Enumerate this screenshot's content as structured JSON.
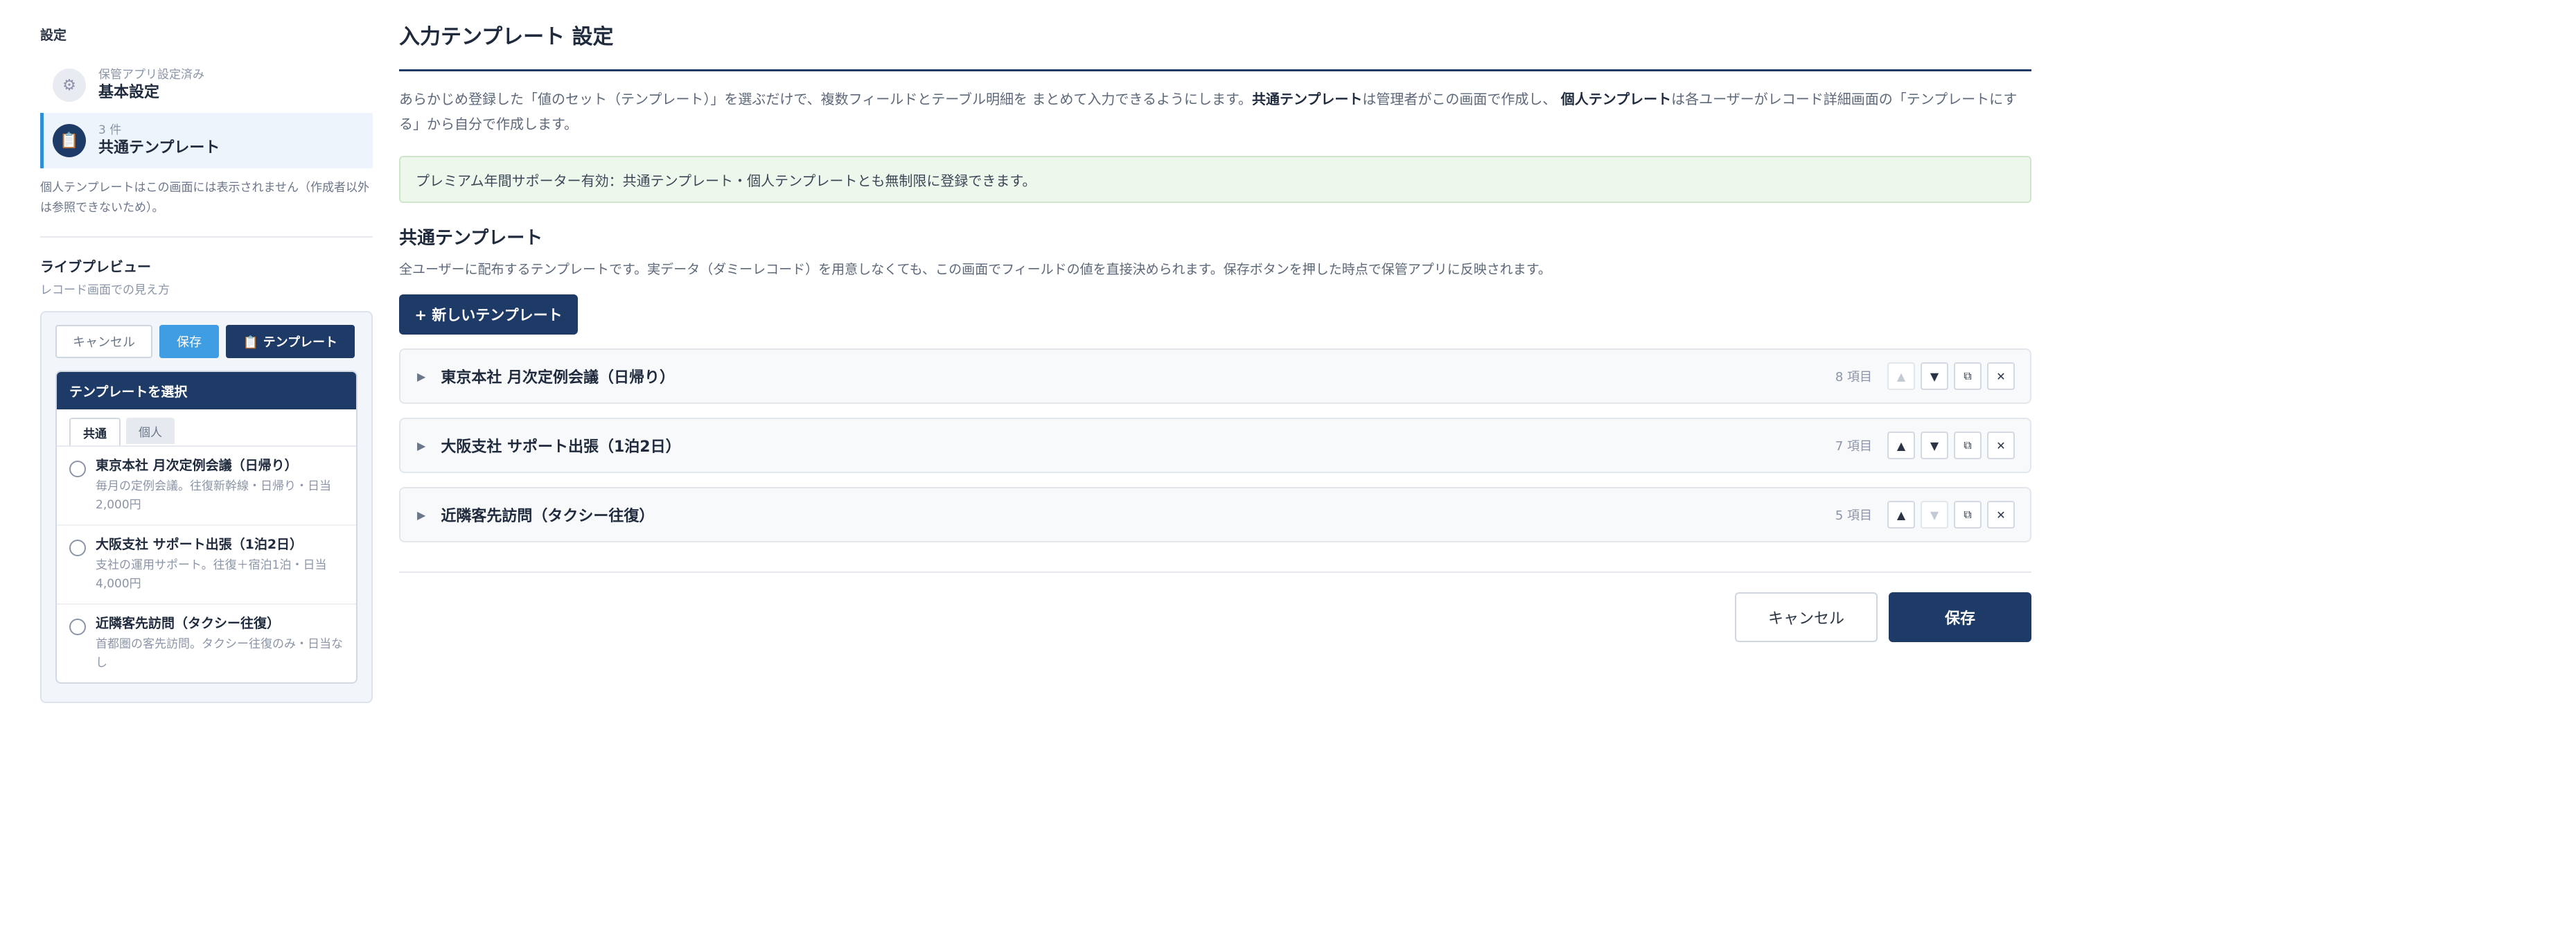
{
  "sidebar": {
    "title": "設定",
    "items": [
      {
        "sub": "保管アプリ設定済み",
        "label": "基本設定",
        "icon": "gear-icon"
      },
      {
        "sub": "3 件",
        "label": "共通テンプレート",
        "icon": "clipboard-icon"
      }
    ],
    "note": "個人テンプレートはこの画面には表示されません（作成者以外は参照できないため）。",
    "live_preview": {
      "title": "ライブプレビュー",
      "subtitle": "レコード画面での見え方",
      "cancel_label": "キャンセル",
      "save_label": "保存",
      "template_label": "📋 テンプレート",
      "panel_title": "テンプレートを選択",
      "tabs": [
        "共通",
        "個人"
      ],
      "items": [
        {
          "title": "東京本社 月次定例会議（日帰り）",
          "desc": "毎月の定例会議。往復新幹線・日帰り・日当2,000円"
        },
        {
          "title": "大阪支社 サポート出張（1泊2日）",
          "desc": "支社の運用サポート。往復＋宿泊1泊・日当4,000円"
        },
        {
          "title": "近隣客先訪問（タクシー往復）",
          "desc": "首都圏の客先訪問。タクシー往復のみ・日当なし"
        }
      ]
    }
  },
  "main": {
    "title": "入力テンプレート 設定",
    "intro_1": "あらかじめ登録した「値のセット（テンプレート）」を選ぶだけで、複数フィールドとテーブル明細を まとめて入力できるようにします。",
    "intro_bold_1": "共通テンプレート",
    "intro_2": "は管理者がこの画面で作成し、 ",
    "intro_bold_2": "個人テンプレート",
    "intro_3": "は各ユーザーがレコード詳細画面の「テンプレートにする」から自分で作成します。",
    "notice": "プレミアム年間サポーター有効：共通テンプレート・個人テンプレートとも無制限に登録できます。",
    "section_title": "共通テンプレート",
    "section_desc": "全ユーザーに配布するテンプレートです。実データ（ダミーレコード）を用意しなくても、この画面でフィールドの値を直接決められます。保存ボタンを押した時点で保管アプリに反映されます。",
    "new_button": "+ 新しいテンプレート",
    "templates": [
      {
        "name": "東京本社 月次定例会議（日帰り）",
        "count": "8 項目"
      },
      {
        "name": "大阪支社 サポート出張（1泊2日）",
        "count": "7 項目"
      },
      {
        "name": "近隣客先訪問（タクシー往復）",
        "count": "5 項目"
      }
    ],
    "cancel_label": "キャンセル",
    "save_label": "保存"
  },
  "icons": {
    "caret": "▶",
    "up": "▲",
    "down": "▼",
    "copy": "⧉",
    "close": "✕"
  },
  "colors": {
    "brand": "#1e3a66",
    "accent": "#2d8fd5",
    "save_preview": "#3e9de3",
    "notice_bg": "#eef7ec"
  }
}
